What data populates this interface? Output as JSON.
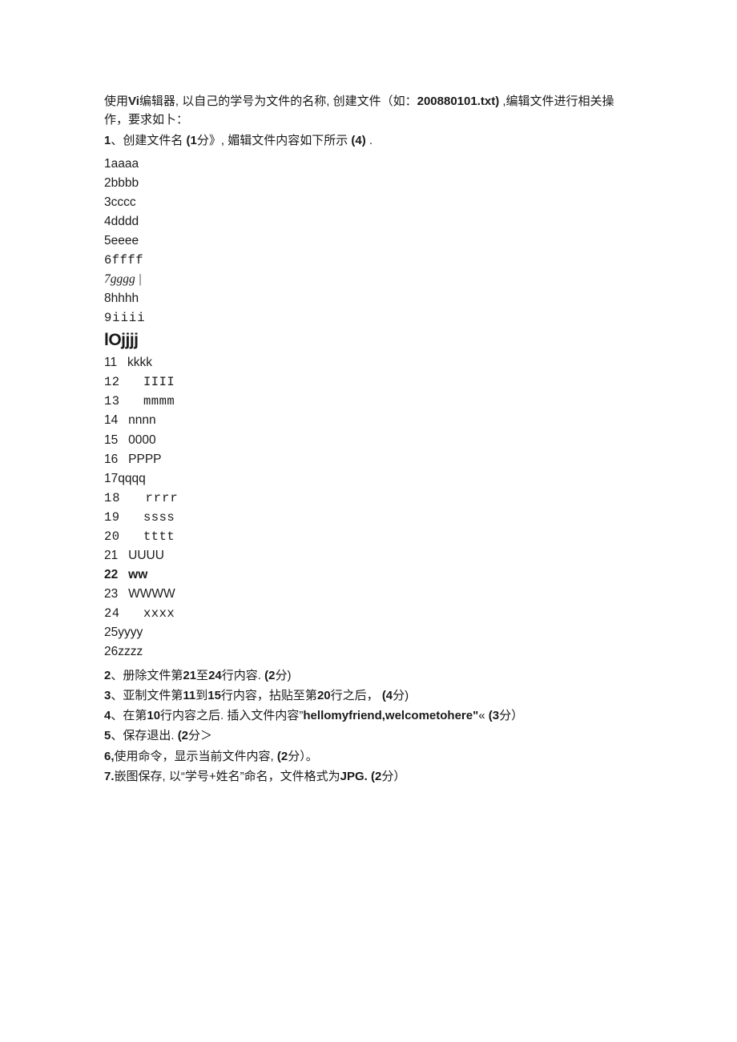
{
  "intro": {
    "line1_pre": "使用",
    "line1_vi": "Vi",
    "line1_mid": "编辑器, 以自己的学号为文件的名称, 创建文件（如：",
    "line1_file": "200880101.txt)",
    "line1_post": " ,编辑文件进行相关操",
    "line2": "作，要求如卜："
  },
  "q1": {
    "pre": "1",
    "mid1": "、创建文件名 ",
    "pts1": "(1",
    "mid2": "分》, 媚辑文件内容如下所示 ",
    "pts2": "(4)",
    "post": " ."
  },
  "file": [
    {
      "txt": "1aaaa",
      "cls": ""
    },
    {
      "txt": "2bbbb",
      "cls": ""
    },
    {
      "txt": "3cccc",
      "cls": ""
    },
    {
      "txt": "4dddd",
      "cls": ""
    },
    {
      "txt": "5eeee",
      "cls": ""
    },
    {
      "txt": "6ffff",
      "cls": "fc-mono"
    },
    {
      "txt": "7gggg |",
      "cls": "fc-ital"
    },
    {
      "txt": "8hhhh",
      "cls": ""
    },
    {
      "txt": "9iiii",
      "cls": "fc-mono fc-spaced"
    },
    {
      "txt": "lOjjjj",
      "cls": "fc-big"
    },
    {
      "txt": "11   kkkk",
      "cls": ""
    },
    {
      "txt": "12   IIII",
      "cls": "fc-mono"
    },
    {
      "txt": "13   mmmm",
      "cls": "fc-mono"
    },
    {
      "txt": "14   nnnn",
      "cls": ""
    },
    {
      "txt": "15   0000",
      "cls": ""
    },
    {
      "txt": "16   PPPP",
      "cls": ""
    },
    {
      "txt": "17qqqq",
      "cls": ""
    },
    {
      "txt": "18   rrrr",
      "cls": "fc-mono fc-spaced"
    },
    {
      "txt": "19   ssss",
      "cls": "fc-mono"
    },
    {
      "txt": "20   tttt",
      "cls": "fc-mono"
    },
    {
      "txt": "21   UUUU",
      "cls": ""
    },
    {
      "txt": "22   ww",
      "cls": "fc-bold"
    },
    {
      "txt": "23   WWWW",
      "cls": ""
    },
    {
      "txt": "24   xxxx",
      "cls": "fc-mono"
    },
    {
      "txt": "25yyyy",
      "cls": ""
    },
    {
      "txt": "26zzzz",
      "cls": ""
    }
  ],
  "questions": {
    "q2": {
      "n": "2",
      "txt": "、册除文件第",
      "b1": "21",
      "m1": "至",
      "b2": "24",
      "m2": "行内容.",
      "pt": "(2",
      "post": "分)"
    },
    "q3": {
      "n": "3",
      "txt": "、亚制文件第",
      "b1": "11",
      "m1": "到",
      "b2": "15",
      "m2": "行内容，拈贴至第",
      "b3": "20",
      "m3": "行之后，",
      "pt": "(4",
      "post": "分)"
    },
    "q4": {
      "n": "4",
      "txt": "、在第",
      "b1": "10",
      "m1": "行内容之后. 插入文件内容”",
      "str": "hellomyfriend,welcometohere\"",
      "tail": "«",
      "pt": "(3",
      "post": "分）"
    },
    "q5": {
      "n": "5",
      "txt": "、保存退出.",
      "pt": "(2",
      "post": "分＞"
    },
    "q6": {
      "n": "6,",
      "txt": "使用命令，显示当前文件内容,",
      "pt": "(2",
      "post": "分）。"
    },
    "q7": {
      "n": "7.",
      "txt": "嵌图保存, 以“学号+姓名”命名，文件格式为",
      "fmt": "JPG.",
      "pt": "(2",
      "post": "分）"
    }
  }
}
